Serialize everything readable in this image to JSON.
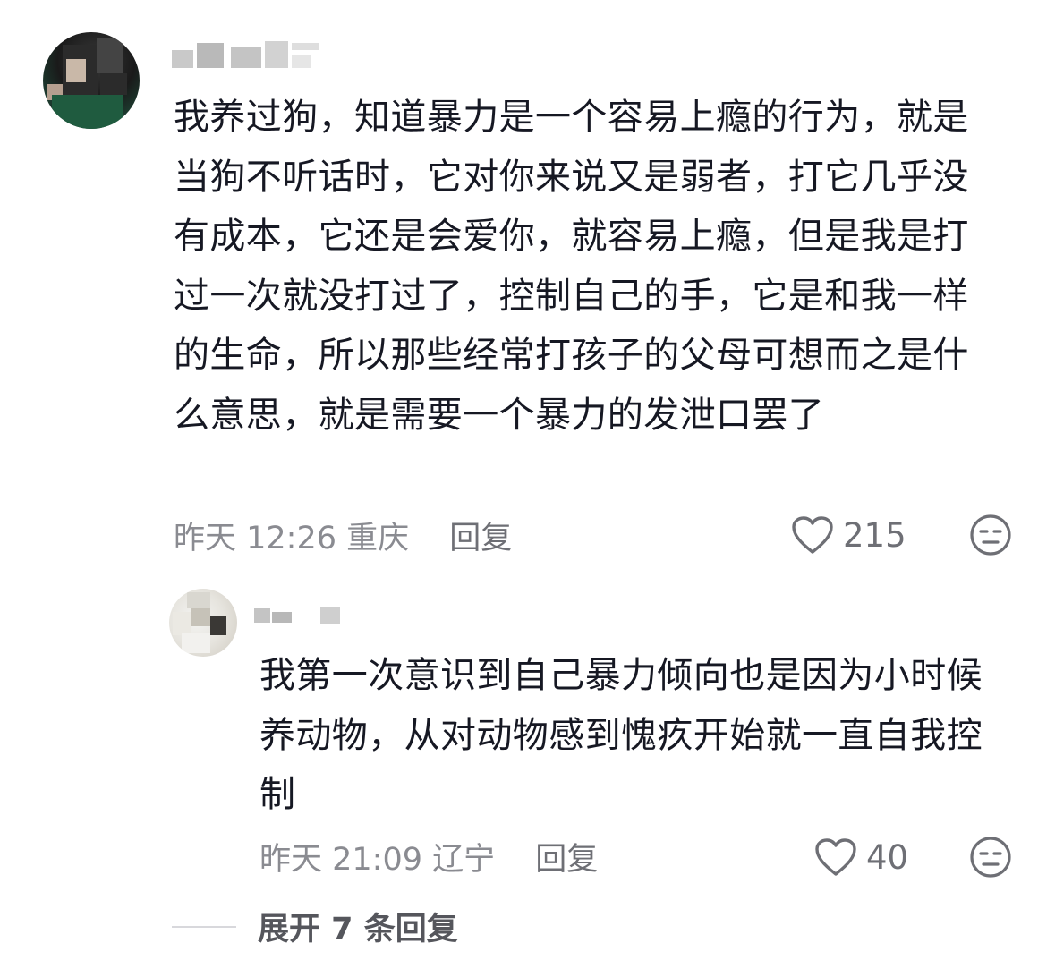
{
  "comments": [
    {
      "username": "佳自来了",
      "text": "我养过狗，知道暴力是一个容易上瘾的行为，就是当狗不听话时，它对你来说又是弱者，打它几乎没有成本，它还是会爱你，就容易上瘾，但是我是打过一次就没打过了，控制自己的手，它是和我一样的生命，所以那些经常打孩子的父母可想而之是什么意思，就是需要一个暴力的发泄口罢了",
      "time": "昨天 12:26",
      "location": "重庆",
      "reply_label": "回复",
      "likes": "215"
    },
    {
      "username": "",
      "text": "我第一次意识到自己暴力倾向也是因为小时候养动物，从对动物感到愧疚开始就一直自我控制",
      "time": "昨天 21:09",
      "location": "辽宁",
      "reply_label": "回复",
      "likes": "40"
    }
  ],
  "expand_replies": "展开 7 条回复",
  "icons": [
    "heart-icon",
    "dislike-face-icon"
  ],
  "colors": {
    "text": "#161823",
    "meta": "#8a8b91",
    "icon": "#6e6f75"
  }
}
